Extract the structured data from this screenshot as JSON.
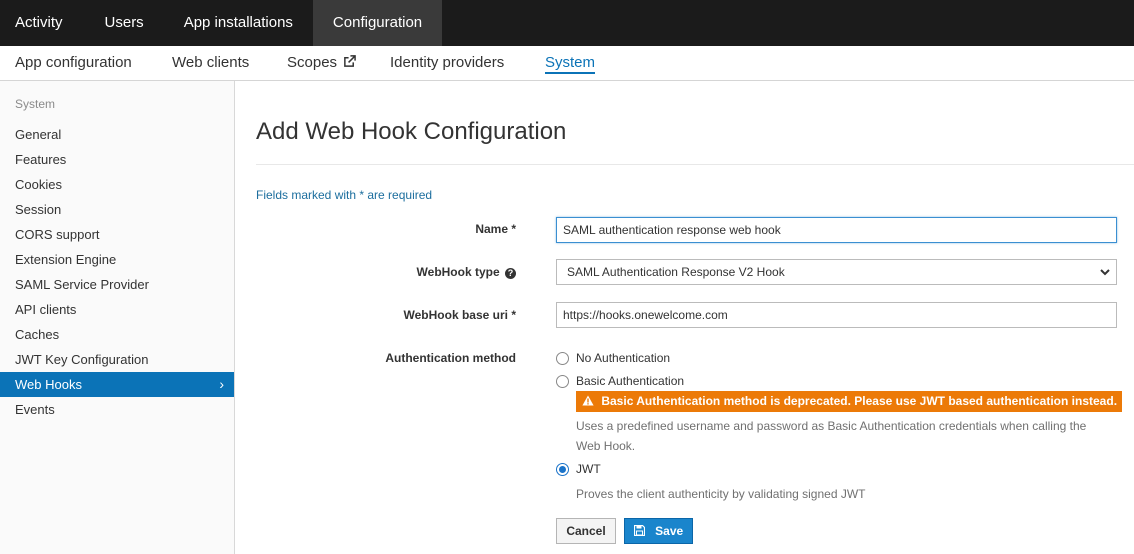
{
  "topnav": {
    "tabs": [
      {
        "label": "Activity"
      },
      {
        "label": "Users"
      },
      {
        "label": "App installations"
      },
      {
        "label": "Configuration"
      }
    ]
  },
  "subnav": {
    "items": [
      {
        "label": "App configuration"
      },
      {
        "label": "Web clients"
      },
      {
        "label": "Scopes"
      },
      {
        "label": "Identity providers"
      },
      {
        "label": "System"
      }
    ]
  },
  "sidebar": {
    "section": "System",
    "items": [
      {
        "label": "General"
      },
      {
        "label": "Features"
      },
      {
        "label": "Cookies"
      },
      {
        "label": "Session"
      },
      {
        "label": "CORS support"
      },
      {
        "label": "Extension Engine"
      },
      {
        "label": "SAML Service Provider"
      },
      {
        "label": "API clients"
      },
      {
        "label": "Caches"
      },
      {
        "label": "JWT Key Configuration"
      },
      {
        "label": "Web Hooks"
      },
      {
        "label": "Events"
      }
    ],
    "chevron": "›"
  },
  "main": {
    "title": "Add Web Hook Configuration",
    "required_note": "Fields marked with * are required",
    "name": {
      "label": "Name *",
      "value": "SAML authentication response web hook"
    },
    "webhook_type": {
      "label": "WebHook type",
      "value": "SAML Authentication Response V2 Hook"
    },
    "base_uri": {
      "label": "WebHook base uri *",
      "value": "https://hooks.onewelcome.com"
    },
    "auth_method": {
      "label": "Authentication method",
      "options": [
        {
          "label": "No Authentication"
        },
        {
          "label": "Basic Authentication"
        },
        {
          "label": "JWT"
        }
      ],
      "warning": "Basic Authentication method is deprecated. Please use JWT based authentication instead.",
      "basic_desc_line1": "Uses a predefined username and password as Basic Authentication credentials when calling the",
      "basic_desc_line2": "Web Hook.",
      "jwt_desc": "Proves the client authenticity by validating signed JWT"
    },
    "buttons": {
      "cancel": "Cancel",
      "save": "Save"
    }
  },
  "colors": {
    "accent": "#0b73b7",
    "warning": "#ec7a08",
    "topnav_bg": "#1b1b1b"
  },
  "icons": [
    "external-link-icon",
    "help-circle-icon",
    "chevron-down-icon",
    "chevron-right-icon",
    "warning-triangle-icon",
    "floppy-disk-icon"
  ]
}
